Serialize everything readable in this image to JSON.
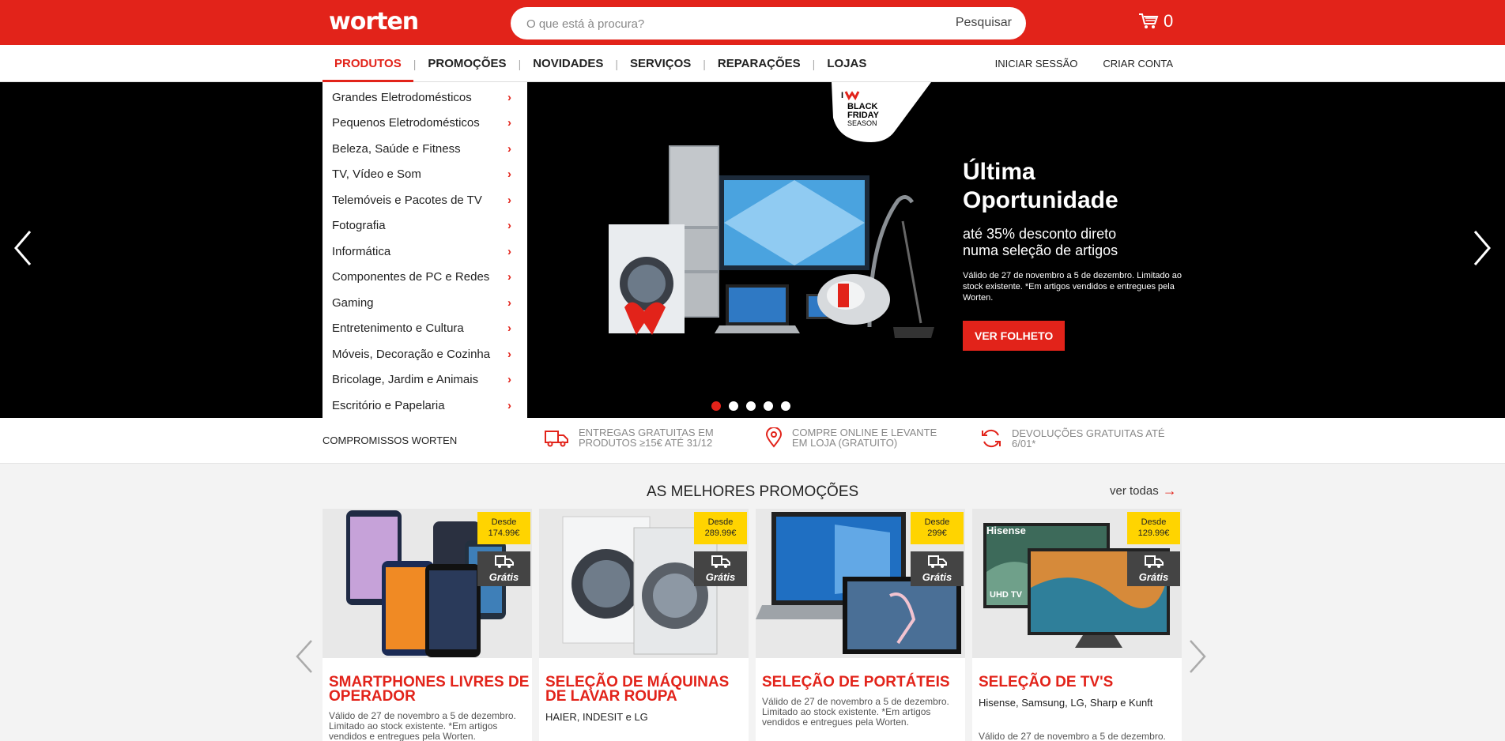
{
  "header": {
    "logo_text": "worten",
    "search_placeholder": "O que está à procura?",
    "search_button": "Pesquisar",
    "cart_count": "0",
    "brand_color": "#e2231a"
  },
  "nav": {
    "items": [
      "PRODUTOS",
      "PROMOÇÕES",
      "NOVIDADES",
      "SERVIÇOS",
      "REPARAÇÕES",
      "LOJAS"
    ],
    "login": "INICIAR SESSÃO",
    "register": "CRIAR CONTA"
  },
  "menu": {
    "items": [
      "Grandes Eletrodomésticos",
      "Pequenos Eletrodomésticos",
      "Beleza, Saúde e Fitness",
      "TV, Vídeo e Som",
      "Telemóveis e Pacotes de TV",
      "Fotografia",
      "Informática",
      "Componentes de PC e Redes",
      "Gaming",
      "Entretenimento e Cultura",
      "Móveis, Decoração e Cozinha",
      "Bricolage, Jardim e Animais",
      "Escritório e Papelaria"
    ]
  },
  "hero": {
    "badge_lines": [
      "BLACK",
      "FRIDAY",
      "SEASON"
    ],
    "title_line1": "Última",
    "title_line2": "Oportunidade",
    "sub_line1": "até 35% desconto direto",
    "sub_line2": "numa seleção de artigos",
    "note": "Válido de 27 de novembro a 5 de dezembro. Limitado ao stock existente. *Em artigos vendidos e entregues pela Worten.",
    "button": "VER FOLHETO",
    "slide_count": 5,
    "active_slide": 1
  },
  "commitments": {
    "title": "COMPROMISSOS WORTEN",
    "items": [
      {
        "icon": "truck-icon",
        "text": "ENTREGAS GRATUITAS EM PRODUTOS ≥15€ ATÉ 31/12"
      },
      {
        "icon": "location-pin-icon",
        "text": "COMPRE ONLINE E LEVANTE EM LOJA (GRATUITO)"
      },
      {
        "icon": "refresh-icon",
        "text": "DEVOLUÇÕES GRATUITAS ATÉ 6/01*"
      }
    ]
  },
  "promotions": {
    "title": "AS MELHORES PROMOÇÕES",
    "see_all": "ver todas",
    "cards": [
      {
        "title": "SMARTPHONES LIVRES DE OPERADOR",
        "price_label": "Desde",
        "price": "174.99€",
        "free_label": "Grátis",
        "desc": "Válido de 27 de novembro a 5 de dezembro. Limitado ao stock existente. *Em artigos vendidos e entregues pela Worten.",
        "brands": ""
      },
      {
        "title": "SELEÇÃO DE MÁQUINAS DE LAVAR ROUPA",
        "price_label": "Desde",
        "price": "289.99€",
        "free_label": "Grátis",
        "desc": "",
        "brands": "HAIER, INDESIT e LG"
      },
      {
        "title": "SELEÇÃO DE PORTÁTEIS",
        "price_label": "Desde",
        "price": "299€",
        "free_label": "Grátis",
        "desc": "Válido de 27 de novembro a 5 de dezembro. Limitado ao stock existente. *Em artigos vendidos e entregues pela Worten.",
        "brands": ""
      },
      {
        "title": "SELEÇÃO DE TV'S",
        "price_label": "Desde",
        "price": "129.99€",
        "free_label": "Grátis",
        "desc": "Válido de 27 de novembro a 5 de dezembro.",
        "brands": "Hisense, Samsung, LG, Sharp e Kunft",
        "tv_brand": "Hisense",
        "tv_badge": "UHD TV"
      }
    ]
  }
}
